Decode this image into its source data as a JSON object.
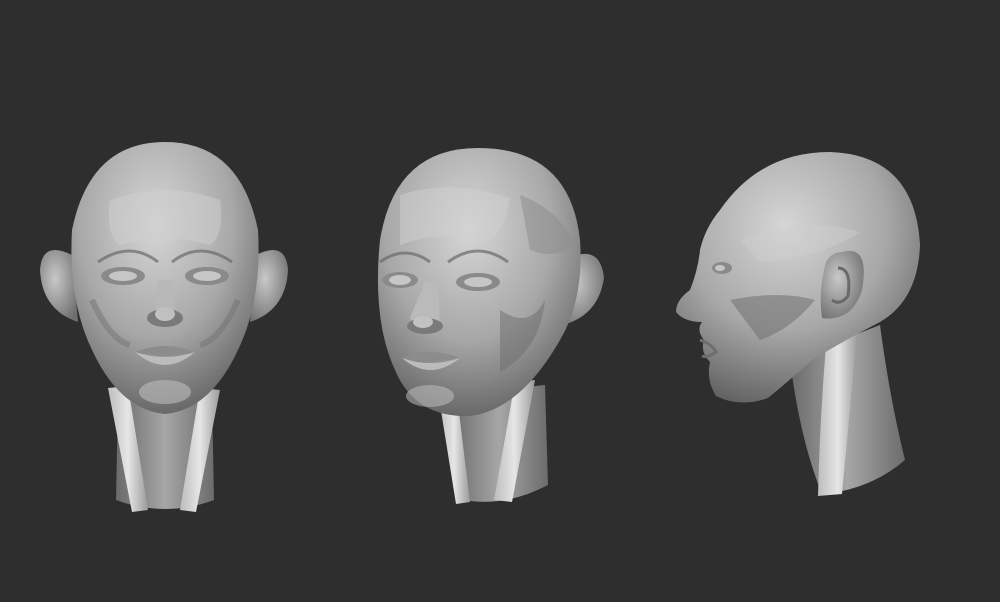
{
  "scene": {
    "background_color": "#2e2e2e",
    "sculpt_base_color": "#a9a9a9",
    "sculpt_highlight_color": "#d2d2d2",
    "sculpt_shadow_color": "#5a5a5a",
    "views": [
      {
        "view": "front"
      },
      {
        "view": "three-quarter"
      },
      {
        "view": "profile"
      }
    ]
  }
}
